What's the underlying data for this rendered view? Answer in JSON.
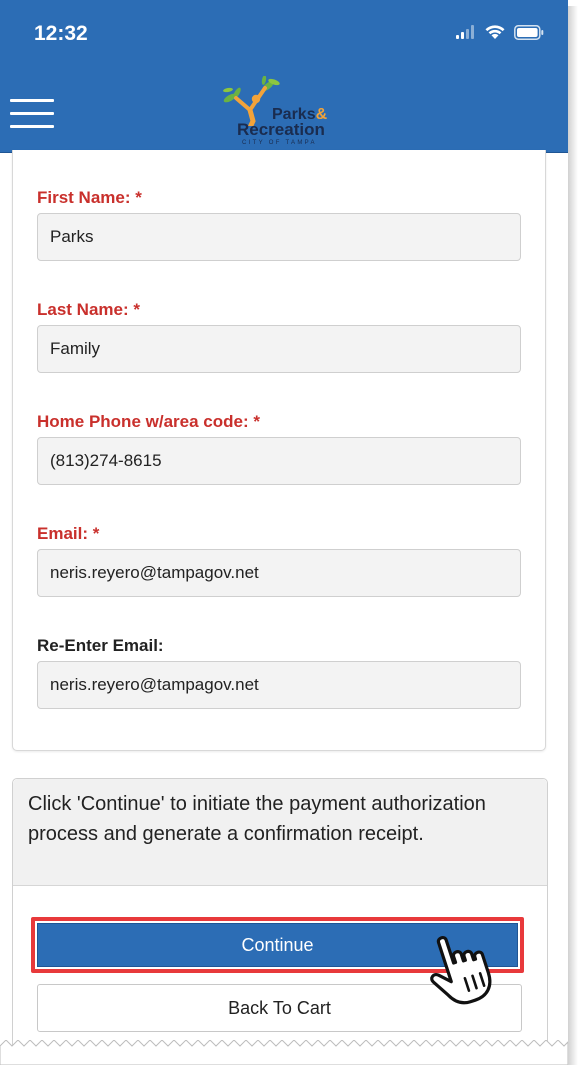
{
  "status_bar": {
    "time": "12:32",
    "icons": [
      "signal-icon",
      "wifi-icon",
      "battery-icon"
    ]
  },
  "header": {
    "menu_icon": "hamburger-menu-icon",
    "logo": {
      "line1": "Parks",
      "line1_amp": "&",
      "line2": "Recreation",
      "line3": "CITY OF TAMPA"
    }
  },
  "form": {
    "first_name": {
      "label": "First Name: *",
      "value": "Parks"
    },
    "last_name": {
      "label": "Last Name: *",
      "value": "Family"
    },
    "home_phone": {
      "label": "Home Phone w/area code: *",
      "value": "(813)274-8615"
    },
    "email": {
      "label": "Email: *",
      "value": "neris.reyero@tampagov.net"
    },
    "reenter_email": {
      "label": "Re-Enter Email:",
      "value": "neris.reyero@tampagov.net"
    }
  },
  "payment": {
    "instructions": "Click 'Continue' to initiate the payment authorization process and generate a confirmation receipt.",
    "continue_label": "Continue",
    "back_label": "Back To Cart"
  },
  "colors": {
    "brand_blue": "#2c6db5",
    "required_red": "#c9302c",
    "highlight_red": "#e8393b"
  }
}
